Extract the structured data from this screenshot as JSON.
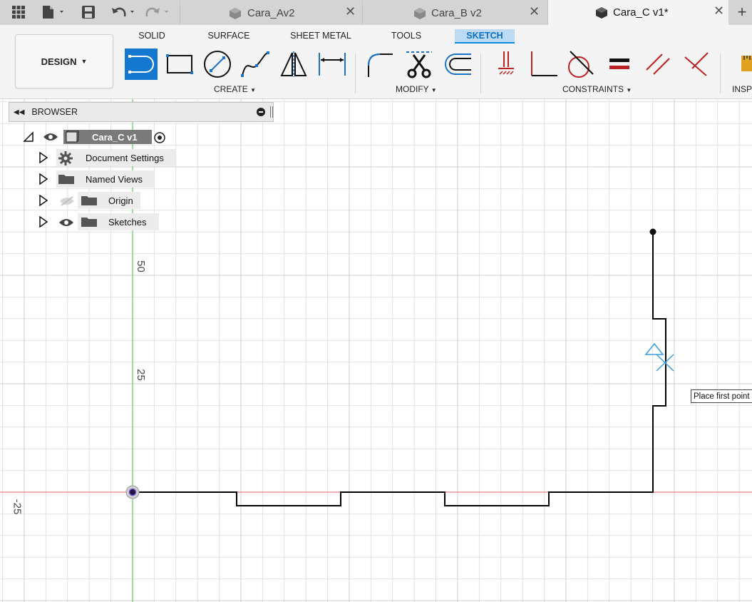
{
  "tabs": [
    {
      "label": "Cara_Av2",
      "active": false
    },
    {
      "label": "Cara_B v2",
      "active": false
    },
    {
      "label": "Cara_C v1*",
      "active": true
    }
  ],
  "toolbar": {
    "workspace_button": "DESIGN",
    "workspace_tabs": [
      "SOLID",
      "SURFACE",
      "SHEET METAL",
      "TOOLS",
      "SKETCH"
    ],
    "active_workspace_tab": "SKETCH",
    "groups": {
      "create": "CREATE",
      "modify": "MODIFY",
      "constraints": "CONSTRAINTS",
      "inspect": "INSPI"
    }
  },
  "browser": {
    "title": "BROWSER",
    "root": "Cara_C v1",
    "items": [
      "Document Settings",
      "Named Views",
      "Origin",
      "Sketches"
    ]
  },
  "canvas": {
    "axis_labels": [
      "50",
      "25",
      "-25"
    ],
    "tooltip": "Place first point",
    "colors": {
      "x_axis": "#e06060",
      "y_axis": "#7fd47f",
      "sketch_line": "#000000",
      "cursor": "#3aa0e0",
      "grid": "#e2e2e2"
    }
  }
}
